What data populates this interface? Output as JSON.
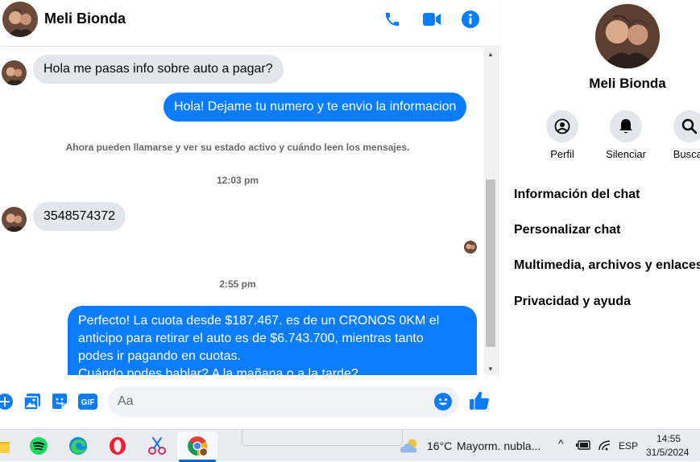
{
  "contact": {
    "name": "Meli Bionda"
  },
  "header": {
    "call_icon": "phone-icon",
    "video_icon": "video-camera-icon",
    "info_icon": "info-icon"
  },
  "messages": {
    "msg1": "Hola me pasas info sobre auto a pagar?",
    "msg2": "Hola! Dejame tu numero y te envio la informacion",
    "system_note": "Ahora pueden llamarse y ver su estado activo y cuándo leen los mensajes.",
    "time1": "12:03 pm",
    "msg3": "3548574372",
    "time2": "2:55 pm",
    "msg4_line1": "Perfecto! La cuota desde $187.467. es de un CRONOS 0KM el",
    "msg4_line2": "anticipo para retirar el auto es de $6.743.700, mientras tanto",
    "msg4_line3": "podes ir pagando en cuotas.",
    "msg4_line4": "Cuándo podes hablar? A la mañana o a la tarde?"
  },
  "composer": {
    "placeholder": "Aa",
    "gif_label": "GIF"
  },
  "info_panel": {
    "name": "Meli Bionda",
    "actions": {
      "profile": "Perfil",
      "mute": "Silenciar",
      "search": "Buscar"
    },
    "menu": {
      "chat_info": "Información del chat",
      "customize": "Personalizar chat",
      "media": "Multimedia, archivos y enlaces",
      "privacy": "Privacidad y ayuda"
    }
  },
  "taskbar": {
    "temperature": "16°C",
    "weather": "Mayorm. nubla...",
    "language": "ESP",
    "time": "14:55",
    "date": "31/5/2024"
  },
  "colors": {
    "accent": "#0a7cff",
    "incoming_bubble": "#e4e6eb",
    "muted_text": "#65676b"
  }
}
